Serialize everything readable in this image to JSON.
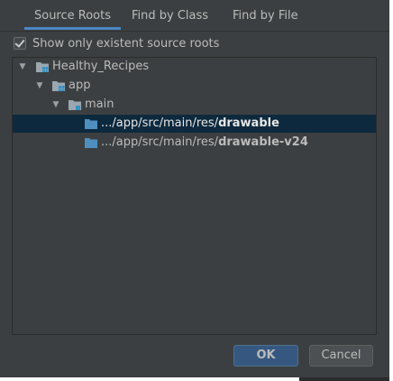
{
  "tabs": [
    {
      "label": "Source Roots",
      "selected": true
    },
    {
      "label": "Find by Class",
      "selected": false
    },
    {
      "label": "Find by File",
      "selected": false
    }
  ],
  "checkbox": {
    "label": "Show only existent source roots",
    "checked": true
  },
  "tree": {
    "project": {
      "label": "Healthy_Recipes",
      "expanded": true
    },
    "module": {
      "label": "app",
      "expanded": true
    },
    "folder": {
      "label": "main",
      "expanded": true
    },
    "roots": [
      {
        "prefix": ".../app/src/main/res/",
        "name": "drawable",
        "selected": true
      },
      {
        "prefix": ".../app/src/main/res/",
        "name": "drawable-v24",
        "selected": false
      }
    ]
  },
  "buttons": {
    "ok": "OK",
    "cancel": "Cancel"
  },
  "colors": {
    "background": "#3c3f41",
    "selection": "#0d293e",
    "accent": "#4a88c7",
    "folder_icon": "#4e8fbf"
  }
}
